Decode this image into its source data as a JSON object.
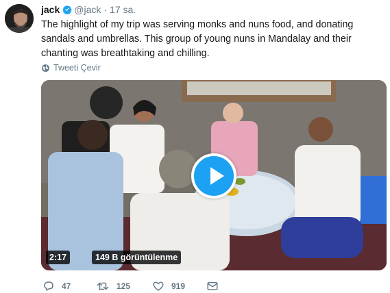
{
  "tweet": {
    "display_name": "jack",
    "handle": "@jack",
    "separator": "·",
    "time": "17 sa.",
    "text": "The highlight of my trip was serving monks and nuns food, and donating sandals and umbrellas. This group of young nuns in Mandalay and their chanting was breathtaking and chilling.",
    "translate_label": "Tweeti Çevir"
  },
  "media": {
    "duration": "2:17",
    "views": "149 B görüntülenme"
  },
  "actions": {
    "replies": "47",
    "retweets": "125",
    "likes": "919"
  },
  "colors": {
    "accent": "#1da1f2",
    "text": "#14171a",
    "muted": "#657786"
  },
  "icons": [
    "verified-icon",
    "globe-icon",
    "play-icon",
    "reply-icon",
    "retweet-icon",
    "like-icon",
    "direct-message-icon"
  ]
}
